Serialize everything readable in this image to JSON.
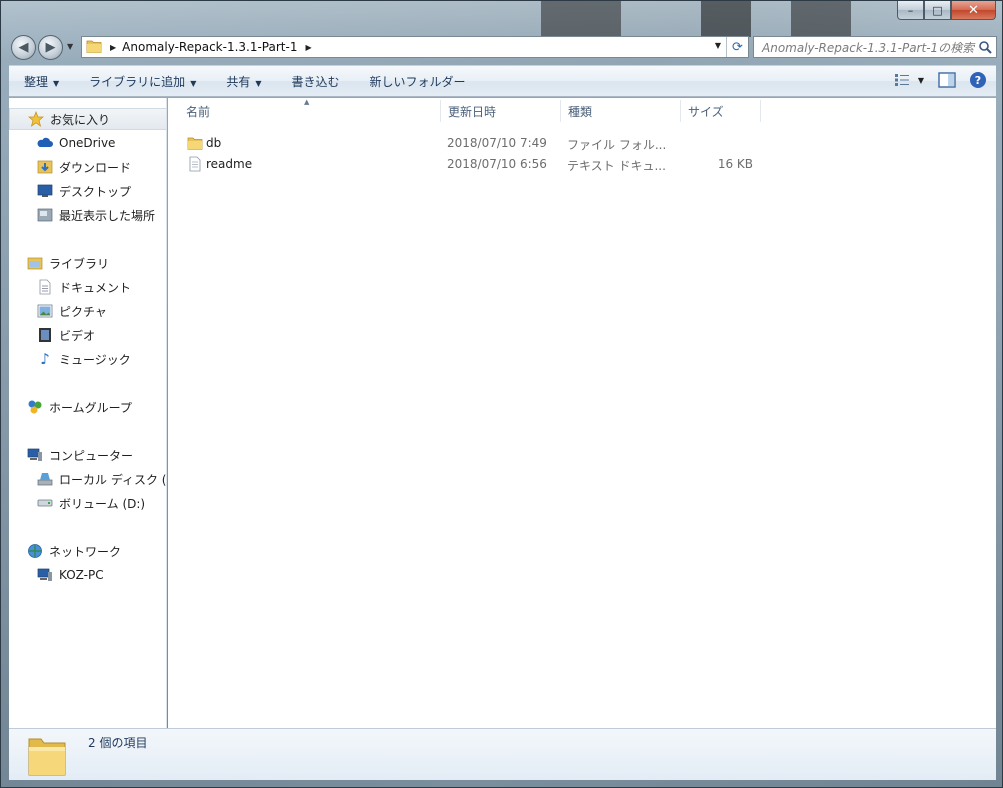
{
  "window": {
    "controls": {
      "minimize": "–",
      "maximize": "□",
      "close": "✕"
    }
  },
  "navigation": {
    "back_icon": "back-arrow-icon",
    "forward_icon": "forward-arrow-icon",
    "breadcrumb": "Anomaly-Repack-1.3.1-Part-1",
    "search_placeholder": "Anomaly-Repack-1.3.1-Part-1の検索"
  },
  "toolbar": {
    "organize": "整理",
    "add_to_library": "ライブラリに追加",
    "share": "共有",
    "burn": "書き込む",
    "new_folder": "新しいフォルダー"
  },
  "sidebar": {
    "favorites": {
      "label": "お気に入り",
      "items": [
        {
          "label": "OneDrive",
          "icon": "cloud-icon"
        },
        {
          "label": "ダウンロード",
          "icon": "download-folder-icon"
        },
        {
          "label": "デスクトップ",
          "icon": "desktop-icon"
        },
        {
          "label": "最近表示した場所",
          "icon": "recent-places-icon"
        }
      ]
    },
    "libraries": {
      "label": "ライブラリ",
      "items": [
        {
          "label": "ドキュメント",
          "icon": "document-icon"
        },
        {
          "label": "ピクチャ",
          "icon": "picture-icon"
        },
        {
          "label": "ビデオ",
          "icon": "video-icon"
        },
        {
          "label": "ミュージック",
          "icon": "music-icon"
        }
      ]
    },
    "homegroup": {
      "label": "ホームグループ"
    },
    "computer": {
      "label": "コンピューター",
      "items": [
        {
          "label": "ローカル ディスク (",
          "icon": "local-disk-icon"
        },
        {
          "label": "ボリューム (D:)",
          "icon": "volume-drive-icon"
        }
      ]
    },
    "network": {
      "label": "ネットワーク",
      "items": [
        {
          "label": "KOZ-PC",
          "icon": "computer-icon"
        }
      ]
    }
  },
  "file_list": {
    "columns": [
      "名前",
      "更新日時",
      "種類",
      "サイズ"
    ],
    "rows": [
      {
        "name": "db",
        "modified": "2018/07/10 7:49",
        "type": "ファイル フォル...",
        "size": "",
        "icon": "folder-icon"
      },
      {
        "name": "readme",
        "modified": "2018/07/10 6:56",
        "type": "テキスト ドキュ...",
        "size": "16 KB",
        "icon": "text-file-icon"
      }
    ]
  },
  "details_pane": {
    "item_count": "2 個の項目"
  }
}
